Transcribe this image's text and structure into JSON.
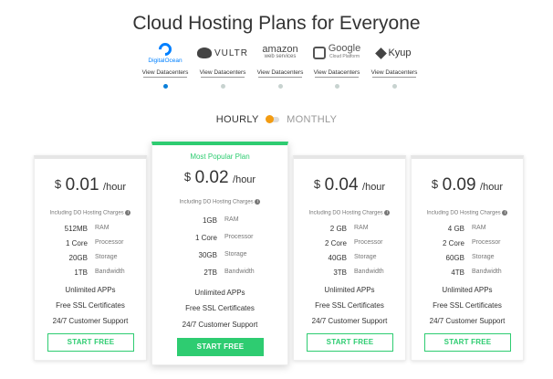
{
  "title": "Cloud Hosting Plans for Everyone",
  "providers": [
    {
      "name": "DigitalOcean",
      "link": "View Datacenters",
      "active": true
    },
    {
      "name": "VULTR",
      "link": "View Datacenters",
      "active": false
    },
    {
      "name": "amazon",
      "subname": "web services",
      "link": "View Datacenters",
      "active": false
    },
    {
      "name": "Google",
      "subname": "Cloud Platform",
      "link": "View Datacenters",
      "active": false
    },
    {
      "name": "Kyup",
      "link": "View Datacenters",
      "active": false
    }
  ],
  "toggle": {
    "left": "HOURLY",
    "right": "MONTHLY"
  },
  "plans": [
    {
      "currency": "$",
      "price": "0.01",
      "period": "/hour",
      "note": "Including DO Hosting Charges",
      "specs": [
        {
          "value": "512MB",
          "label": "RAM"
        },
        {
          "value": "1 Core",
          "label": "Processor"
        },
        {
          "value": "20GB",
          "label": "Storage"
        },
        {
          "value": "1TB",
          "label": "Bandwidth"
        }
      ],
      "features": [
        "Unlimited APPs",
        "Free SSL Certificates",
        "24/7 Customer Support"
      ],
      "button": "START FREE"
    },
    {
      "popular": "Most Popular Plan",
      "currency": "$",
      "price": "0.02",
      "period": "/hour",
      "note": "Including DO Hosting Charges",
      "specs": [
        {
          "value": "1GB",
          "label": "RAM"
        },
        {
          "value": "1 Core",
          "label": "Processor"
        },
        {
          "value": "30GB",
          "label": "Storage"
        },
        {
          "value": "2TB",
          "label": "Bandwidth"
        }
      ],
      "features": [
        "Unlimited APPs",
        "Free SSL Certificates",
        "24/7 Customer Support"
      ],
      "button": "START FREE"
    },
    {
      "currency": "$",
      "price": "0.04",
      "period": "/hour",
      "note": "Including DO Hosting Charges",
      "specs": [
        {
          "value": "2 GB",
          "label": "RAM"
        },
        {
          "value": "2 Core",
          "label": "Processor"
        },
        {
          "value": "40GB",
          "label": "Storage"
        },
        {
          "value": "3TB",
          "label": "Bandwidth"
        }
      ],
      "features": [
        "Unlimited APPs",
        "Free SSL Certificates",
        "24/7 Customer Support"
      ],
      "button": "START FREE"
    },
    {
      "currency": "$",
      "price": "0.09",
      "period": "/hour",
      "note": "Including DO Hosting Charges",
      "specs": [
        {
          "value": "4 GB",
          "label": "RAM"
        },
        {
          "value": "2 Core",
          "label": "Processor"
        },
        {
          "value": "60GB",
          "label": "Storage"
        },
        {
          "value": "4TB",
          "label": "Bandwidth"
        }
      ],
      "features": [
        "Unlimited APPs",
        "Free SSL Certificates",
        "24/7 Customer Support"
      ],
      "button": "START FREE"
    }
  ],
  "colors": {
    "accent": "#2ecc71",
    "do_blue": "#0080ff",
    "toggle": "#f39c12"
  }
}
